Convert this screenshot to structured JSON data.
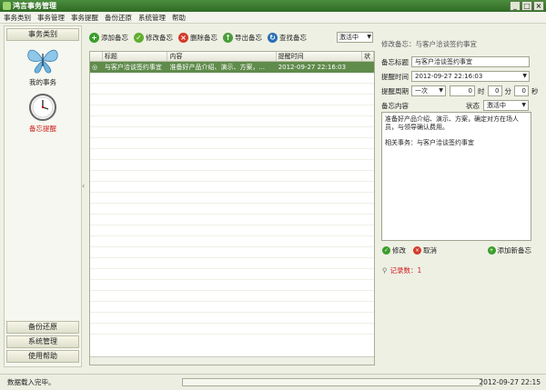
{
  "window": {
    "title": "鸿言事务管理"
  },
  "menu": [
    "事务类别",
    "事务管理",
    "事务提醒",
    "备份还原",
    "系统管理",
    "帮助"
  ],
  "sidebar": {
    "header": "事务类别",
    "items": [
      {
        "label": "我的事务",
        "icon": "butterfly-icon"
      },
      {
        "label": "备忘提醒",
        "icon": "clock-icon"
      }
    ],
    "bottom": [
      "备份还原",
      "系统管理",
      "使用帮助"
    ]
  },
  "toolbar": {
    "add": "添加备忘",
    "edit": "修改备忘",
    "delete": "删除备忘",
    "export": "导出备忘",
    "find": "查找备忘",
    "filter": "激活中"
  },
  "grid": {
    "columns": [
      "",
      "标题",
      "内容",
      "提醒时间",
      "状"
    ],
    "rows": [
      {
        "title": "与客户洽谈签约事宜",
        "content": "准备好产品介绍、演示、方案，...",
        "time": "2012-09-27 22:16:03"
      }
    ]
  },
  "detail": {
    "panel_title": "修改备忘：与客户洽谈签约事宜",
    "title_label": "备忘标题",
    "title_value": "与客户洽谈签约事宜",
    "time_label": "提醒时间",
    "time_value": "2012-09-27 22:16:03",
    "period_label": "提醒周期",
    "period_value": "一次",
    "period_d": "0",
    "unit_d": "时",
    "period_m": "0",
    "unit_m": "分",
    "period_s": "0",
    "unit_s": "秒",
    "content_label": "备忘内容",
    "status_label": "状态",
    "status_value": "激活中",
    "content_p1": "准备好产品介绍、演示、方案，确定对方在场人员，与领导确认费用。",
    "content_p2": "相关事务：与客户洽谈签约事宜",
    "save": "修改",
    "cancel": "取消",
    "add_new": "添加新备忘",
    "record": "记录数：1"
  },
  "status": {
    "message": "数据载入完毕。",
    "datetime": "2012-09-27 22:15"
  }
}
